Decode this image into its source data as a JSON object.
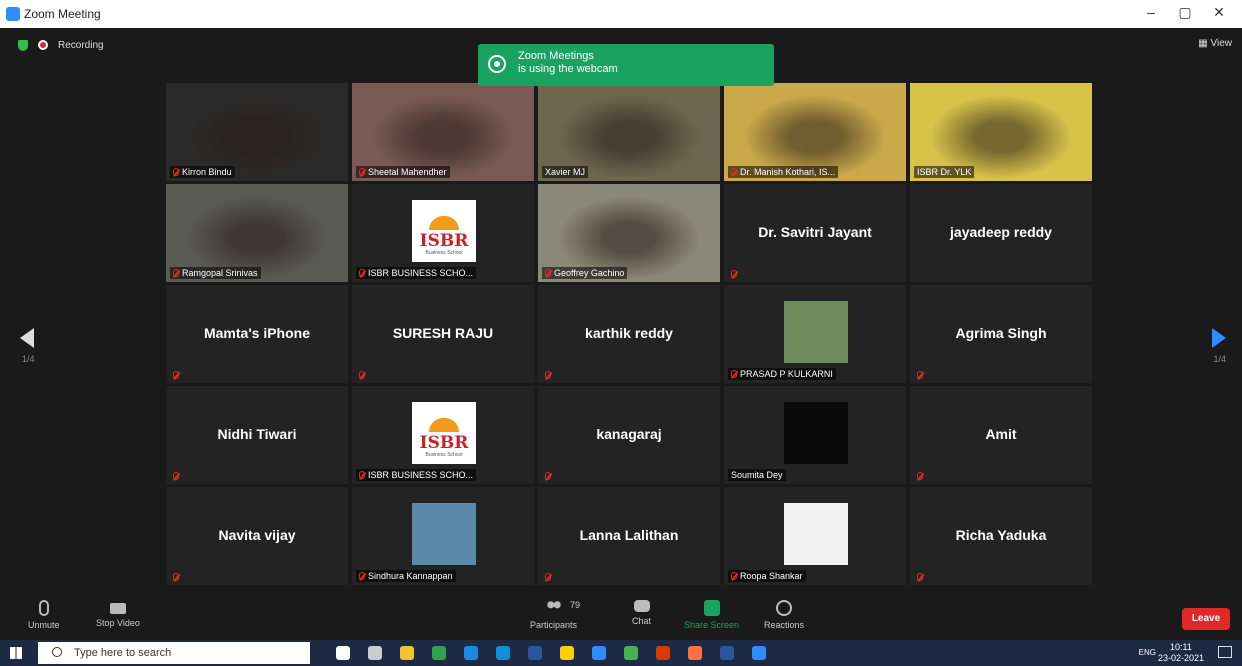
{
  "window": {
    "title": "Zoom Meeting",
    "controls": [
      "–",
      "▢",
      "✕"
    ]
  },
  "status": {
    "recording_label": "Recording",
    "view_label": "▦ View"
  },
  "toast": {
    "line1": "Zoom Meetings",
    "line2": "is using the webcam"
  },
  "pagination": {
    "left": "1/4",
    "right": "1/4"
  },
  "participants": [
    {
      "name": "Kirron Bindu",
      "display": "",
      "type": "video",
      "bg": "#2a2a2a",
      "muted": true
    },
    {
      "name": "Sheetal Mahendher",
      "display": "",
      "type": "video",
      "bg": "#7a5a55",
      "muted": true
    },
    {
      "name": "Xavier MJ",
      "display": "",
      "type": "video",
      "bg": "#6f6650",
      "muted": false,
      "speaking": true
    },
    {
      "name": "Dr. Manish Kothari, IS...",
      "display": "",
      "type": "video",
      "bg": "#c9a94a",
      "muted": true
    },
    {
      "name": "ISBR Dr. YLK",
      "display": "",
      "type": "video",
      "bg": "#d8c24a",
      "muted": false
    },
    {
      "name": "Ramgopal Srinivas",
      "display": "",
      "type": "video",
      "bg": "#5a5a55",
      "muted": true
    },
    {
      "name": "ISBR BUSINESS SCHO...",
      "display": "",
      "type": "isbr",
      "bg": "#232323",
      "muted": true
    },
    {
      "name": "Geoffrey Gachino",
      "display": "",
      "type": "video",
      "bg": "#8a8878",
      "muted": true
    },
    {
      "name": "",
      "display": "Dr. Savitri Jayant",
      "type": "name",
      "bg": "#232323",
      "muted": true
    },
    {
      "name": "",
      "display": "jayadeep reddy",
      "type": "name",
      "bg": "#232323",
      "muted": false
    },
    {
      "name": "",
      "display": "Mamta's iPhone",
      "type": "name",
      "bg": "#232323",
      "muted": true
    },
    {
      "name": "",
      "display": "SURESH RAJU",
      "type": "name",
      "bg": "#232323",
      "muted": true
    },
    {
      "name": "",
      "display": "karthik reddy",
      "type": "name",
      "bg": "#232323",
      "muted": true
    },
    {
      "name": "PRASAD P KULKARNI",
      "display": "",
      "type": "photo",
      "bg": "#232323",
      "photo": "#6f8a5a",
      "muted": true
    },
    {
      "name": "",
      "display": "Agrima Singh",
      "type": "name",
      "bg": "#232323",
      "muted": true
    },
    {
      "name": "",
      "display": "Nidhi Tiwari",
      "type": "name",
      "bg": "#232323",
      "muted": true
    },
    {
      "name": "ISBR BUSINESS SCHO...",
      "display": "",
      "type": "isbr",
      "bg": "#232323",
      "muted": true
    },
    {
      "name": "",
      "display": "kanagaraj",
      "type": "name",
      "bg": "#232323",
      "muted": true
    },
    {
      "name": "Soumita Dey",
      "display": "",
      "type": "photo",
      "bg": "#232323",
      "photo": "#0a0a0a",
      "muted": false
    },
    {
      "name": "",
      "display": "Amit",
      "type": "name",
      "bg": "#232323",
      "muted": true
    },
    {
      "name": "",
      "display": "Navita vijay",
      "type": "name",
      "bg": "#232323",
      "muted": true
    },
    {
      "name": "Sindhura Kannappan",
      "display": "",
      "type": "photo",
      "bg": "#232323",
      "photo": "#5a8aa8",
      "muted": true
    },
    {
      "name": "",
      "display": "Lanna Lalithan",
      "type": "name",
      "bg": "#232323",
      "muted": true
    },
    {
      "name": "Roopa Shankar",
      "display": "",
      "type": "photo",
      "bg": "#232323",
      "photo": "#f2f2f2",
      "muted": true
    },
    {
      "name": "",
      "display": "Richa Yaduka",
      "type": "name",
      "bg": "#232323",
      "muted": true
    }
  ],
  "isbr_logo": {
    "text": "ISBR",
    "sub": "Business School"
  },
  "toolbar": {
    "unmute": "Unmute",
    "stop_video": "Stop Video",
    "participants": "Participants",
    "participant_count": "79",
    "chat": "Chat",
    "share_screen": "Share Screen",
    "reactions": "Reactions",
    "leave": "Leave"
  },
  "taskbar": {
    "search_placeholder": "Type here to search",
    "lang": "ENG",
    "time": "10:11",
    "date": "23-02-2021",
    "app_colors": [
      "#ffffff",
      "#cccccc",
      "#f4c430",
      "#2fa14f",
      "#1e88e5",
      "#0f8fd6",
      "#2b579a",
      "#ffd000",
      "#2d8cff",
      "#4caf50",
      "#d83b01",
      "#ff7043",
      "#2b579a",
      "#2d8cff"
    ]
  }
}
